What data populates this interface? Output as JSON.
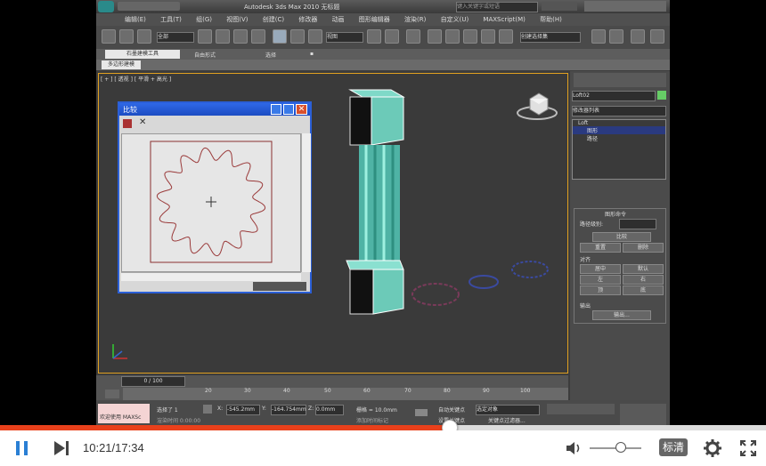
{
  "app": {
    "title": "Autodesk 3ds Max  2010      无标题",
    "search_placeholder": "键入关键字或短语",
    "menu": [
      "编辑(E)",
      "工具(T)",
      "组(G)",
      "视图(V)",
      "创建(C)",
      "修改器",
      "动画",
      "图形编辑器",
      "渲染(R)",
      "自定义(U)",
      "MAXScript(M)",
      "帮助(H)"
    ],
    "toolbar": {
      "selection_filter": "全部",
      "view_dropdown": "视图",
      "named_set": "创建选择集"
    },
    "ribbon_tabs": [
      "石墨建模工具",
      "自由形式",
      "选择",
      "▪"
    ],
    "ribbon_sub": "多边形建模",
    "viewport_label": "[ + ] [ 透视 ] [ 平滑 + 高光 ]"
  },
  "dialog": {
    "title": "比较"
  },
  "command_panel": {
    "object_name": "Loft02",
    "modifier_list": "修改器列表",
    "stack": [
      "Loft",
      "图形",
      "路径"
    ],
    "rollout_title": "图形命令",
    "path_level_label": "路径级别:",
    "compare_button": "比较",
    "reset_button": "重置",
    "delete_button": "删除",
    "align_label": "对齐",
    "align_buttons": [
      "居中",
      "默认",
      "左",
      "右",
      "顶",
      "底"
    ],
    "output_label": "输出",
    "output_button": "输出..."
  },
  "timeline": {
    "frame": "0 / 100",
    "ticks": [
      "20",
      "30",
      "40",
      "50",
      "60",
      "70",
      "80",
      "90",
      "100"
    ]
  },
  "status": {
    "welcome": "欢迎使用 MAXSc",
    "selected": "选择了 1",
    "x_label": "X:",
    "x_value": "-545.2mm",
    "y_label": "Y:",
    "y_value": "-164.754mm",
    "z_label": "Z:",
    "z_value": "0.0mm",
    "grid": "栅格 = 10.0mm",
    "auto_key": "自动关键点",
    "selected_obj": "选定对象",
    "set_key": "设置关键点",
    "key_filter": "关键点过滤器...",
    "add_time_tag": "添加时间标记",
    "render_time": "渲染时间 0:00:00"
  },
  "player": {
    "current_time": "10:21",
    "total_time": "17:34",
    "time_text": "10:21/17:34",
    "progress": 0.5863,
    "volume": 0.6,
    "quality_label": "标清",
    "colors": {
      "progress": "#e9401b",
      "icon": "#2a7fd4",
      "background": "#ffffff"
    }
  }
}
